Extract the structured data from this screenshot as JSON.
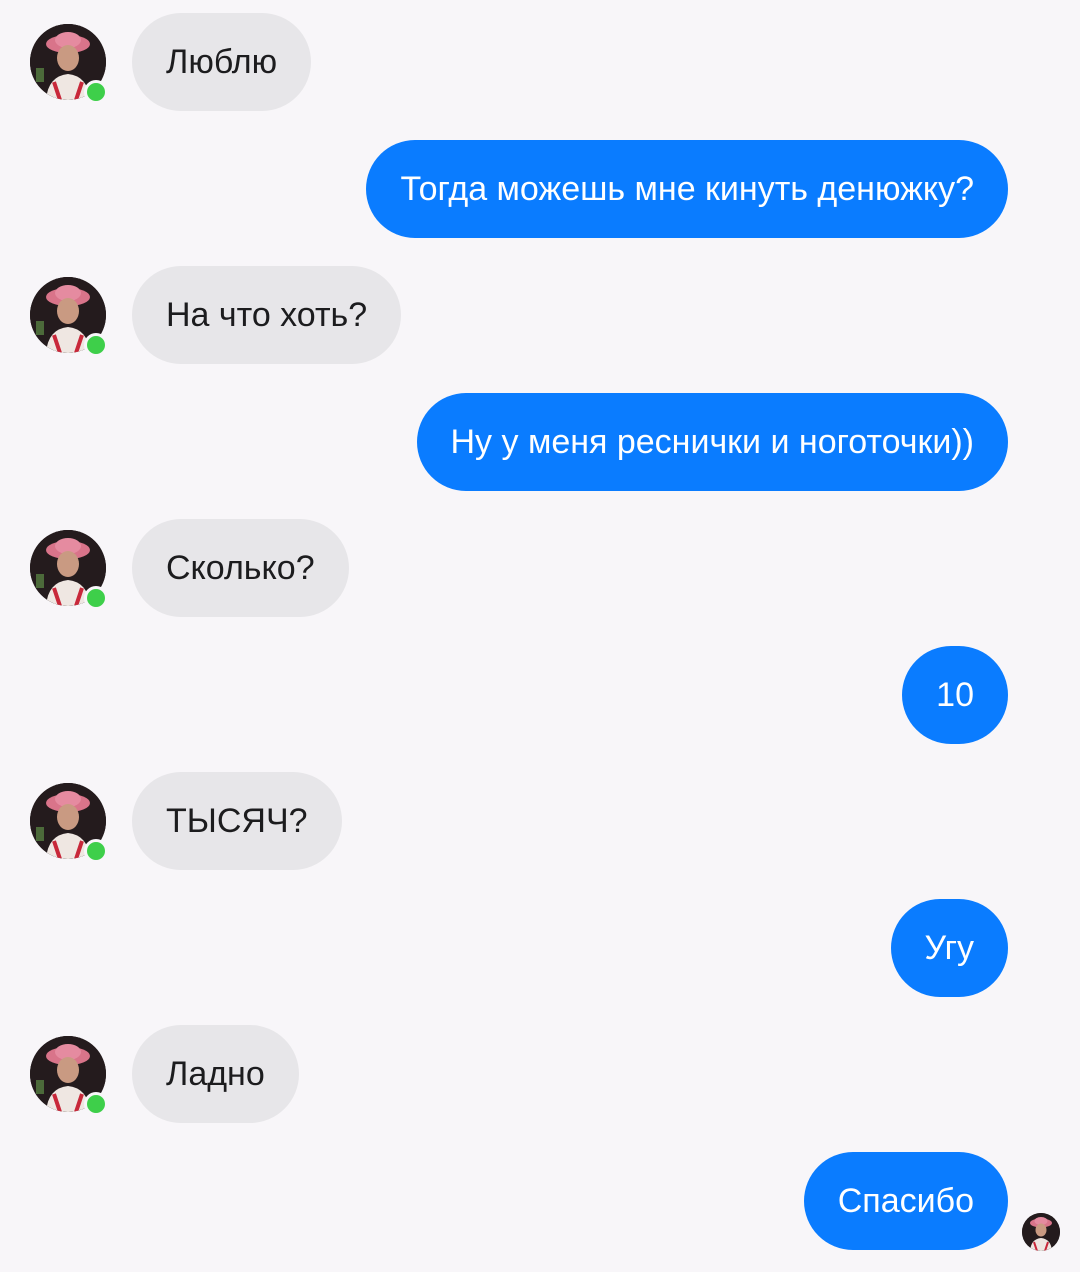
{
  "conversation": {
    "messages": [
      {
        "side": "in",
        "text": "Люблю",
        "contact_online": true
      },
      {
        "side": "out",
        "text": "Тогда можешь мне кинуть денюжку?"
      },
      {
        "side": "in",
        "text": "На что хоть?",
        "contact_online": true
      },
      {
        "side": "out",
        "text": "Ну у меня реснички и ноготочки))"
      },
      {
        "side": "in",
        "text": "Сколько?",
        "contact_online": true
      },
      {
        "side": "out",
        "text": "10"
      },
      {
        "side": "in",
        "text": "ТЫСЯЧ?",
        "contact_online": true
      },
      {
        "side": "out",
        "text": "Угу"
      },
      {
        "side": "in",
        "text": "Ладно",
        "contact_online": true
      },
      {
        "side": "out",
        "text": "Спасибо",
        "seen": true
      }
    ]
  },
  "colors": {
    "background": "#f8f6f9",
    "incoming_bubble": "#e7e6e9",
    "outgoing_bubble": "#0a7cff",
    "online_indicator": "#3ecf4a"
  }
}
